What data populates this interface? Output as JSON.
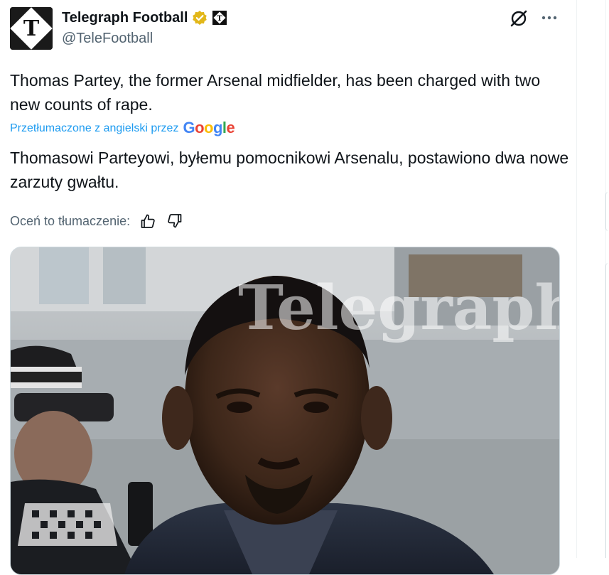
{
  "tweet": {
    "author_name": "Telegraph Football",
    "author_handle": "@TeleFootball",
    "text": "Thomas Partey, the former Arsenal midfielder, has been charged with two new counts of rape.",
    "translated_label": "Przetłumaczone z angielski przez",
    "translator_brand": "Google",
    "translation": "Thomasowi Parteyowi, byłemu pomocnikowi Arsenalu, postawiono dwa nowe zarzuty gwałtu.",
    "rate_label": "Oceń to tłumaczenie:"
  },
  "media": {
    "watermark": "Telegraph"
  },
  "icons": {
    "verified": "verified-badge-icon",
    "affiliate": "telegraph-affiliate-icon",
    "grok": "grok-icon",
    "more": "more-icon",
    "thumbs_up": "thumbs-up-icon",
    "thumbs_down": "thumbs-down-icon"
  },
  "colors": {
    "link": "#1d9bf0",
    "secondary_text": "#536471",
    "verified_gold": "#e2b719"
  }
}
